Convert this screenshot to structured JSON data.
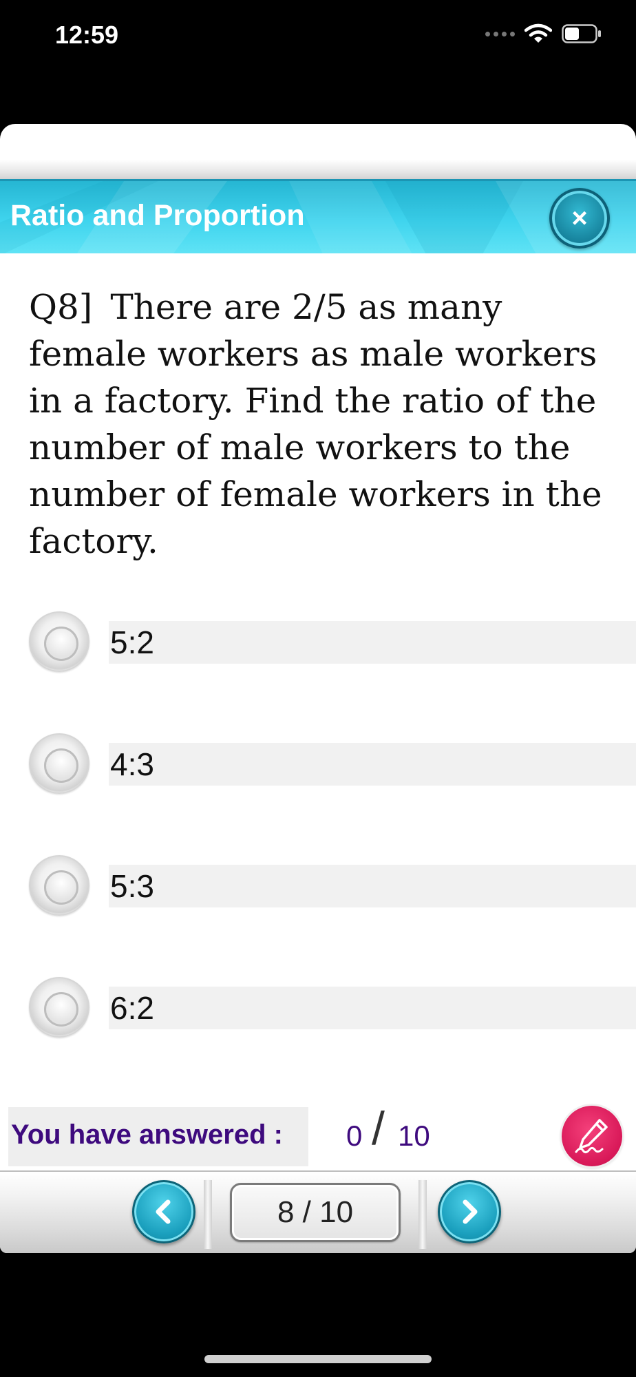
{
  "status_bar": {
    "time": "12:59",
    "icons": [
      "signal-dots-icon",
      "wifi-icon",
      "battery-icon"
    ]
  },
  "header": {
    "title": "Ratio and Proportion",
    "close_icon": "close-icon",
    "accent_color": "#3fd4ee"
  },
  "question": {
    "number": "Q8]",
    "text": "There are 2/5 as many female workers as male workers in a factory. Find the ratio of the number of male workers to the number of female workers in the factory."
  },
  "options": [
    {
      "label": "5:2",
      "selected": false
    },
    {
      "label": "4:3",
      "selected": false
    },
    {
      "label": "5:3",
      "selected": false
    },
    {
      "label": "6:2",
      "selected": false
    }
  ],
  "progress": {
    "label": "You have answered :",
    "answered": "0",
    "separator": "/",
    "total": "10",
    "label_color": "#3e0a7e",
    "pen_icon": "pen-icon"
  },
  "navigation": {
    "prev_icon": "chevron-left-icon",
    "next_icon": "chevron-right-icon",
    "page_indicator": "8 / 10"
  }
}
